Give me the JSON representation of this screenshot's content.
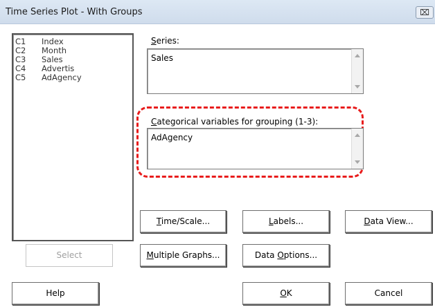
{
  "window": {
    "title": "Time Series Plot - With Groups",
    "close_glyph": "⌧"
  },
  "variables": [
    {
      "col": "C1",
      "name": "Index"
    },
    {
      "col": "C2",
      "name": "Month"
    },
    {
      "col": "C3",
      "name": "Sales"
    },
    {
      "col": "C4",
      "name": "Advertis"
    },
    {
      "col": "C5",
      "name": "AdAgency"
    }
  ],
  "series": {
    "label_first": "S",
    "label_rest": "eries:",
    "value": "Sales"
  },
  "grouping": {
    "label_first": "C",
    "label_rest": "ategorical variables for grouping (1-3):",
    "value": "AdAgency",
    "highlight_color": "#e81c1c"
  },
  "buttons": {
    "time_scale": {
      "u": "T",
      "rest": "ime/Scale..."
    },
    "labels": {
      "u": "L",
      "rest": "abels..."
    },
    "data_view": {
      "u": "D",
      "rest": "ata View..."
    },
    "multiple_graphs": {
      "u": "M",
      "rest": "ultiple Graphs..."
    },
    "data_options": {
      "pre": "Data ",
      "u": "O",
      "rest": "ptions..."
    },
    "select": "Select",
    "help": "Help",
    "ok": {
      "u": "O",
      "rest": "K"
    },
    "cancel": "Cancel"
  }
}
